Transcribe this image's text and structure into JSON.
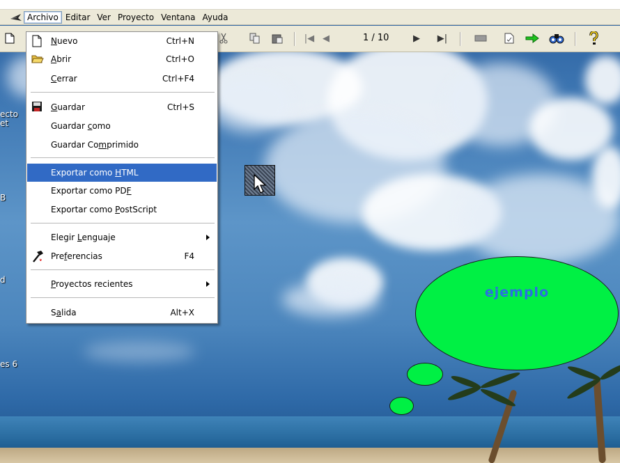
{
  "menubar": {
    "items": [
      {
        "label": "Archivo"
      },
      {
        "label": "Editar"
      },
      {
        "label": "Ver"
      },
      {
        "label": "Proyecto"
      },
      {
        "label": "Ventana"
      },
      {
        "label": "Ayuda"
      }
    ]
  },
  "toolbar": {
    "page_indicator": "1 / 10"
  },
  "desktop": {
    "icon_labels": [
      "ecto\net",
      "B",
      "d",
      "es 6"
    ]
  },
  "file_menu": {
    "items": [
      {
        "pre": "",
        "u": "N",
        "post": "uevo",
        "shortcut": "Ctrl+N"
      },
      {
        "pre": "",
        "u": "A",
        "post": "brir",
        "shortcut": "Ctrl+O"
      },
      {
        "pre": "",
        "u": "C",
        "post": "errar",
        "shortcut": "Ctrl+F4"
      },
      {
        "pre": "",
        "u": "G",
        "post": "uardar",
        "shortcut": "Ctrl+S"
      },
      {
        "pre": "Guardar ",
        "u": "c",
        "post": "omo",
        "shortcut": ""
      },
      {
        "pre": "Guardar Co",
        "u": "m",
        "post": "primido",
        "shortcut": ""
      },
      {
        "pre": "Exportar como ",
        "u": "H",
        "post": "TML",
        "shortcut": ""
      },
      {
        "pre": "Exportar como PD",
        "u": "F",
        "post": "",
        "shortcut": ""
      },
      {
        "pre": "Exportar como ",
        "u": "P",
        "post": "ostScript",
        "shortcut": ""
      },
      {
        "pre": "Elegir ",
        "u": "L",
        "post": "enguaje",
        "shortcut": ""
      },
      {
        "pre": "Pre",
        "u": "f",
        "post": "erencias",
        "shortcut": "F4"
      },
      {
        "pre": "",
        "u": "P",
        "post": "royectos recientes",
        "shortcut": ""
      },
      {
        "pre": "S",
        "u": "a",
        "post": "lida",
        "shortcut": "Alt+X"
      }
    ]
  },
  "canvas": {
    "bubble_text": "ejemplo",
    "bubble_color": "#00f044",
    "bubble_text_color": "#2b6fe0"
  },
  "colors": {
    "highlight": "#316ac5",
    "chrome": "#ece9d8"
  }
}
